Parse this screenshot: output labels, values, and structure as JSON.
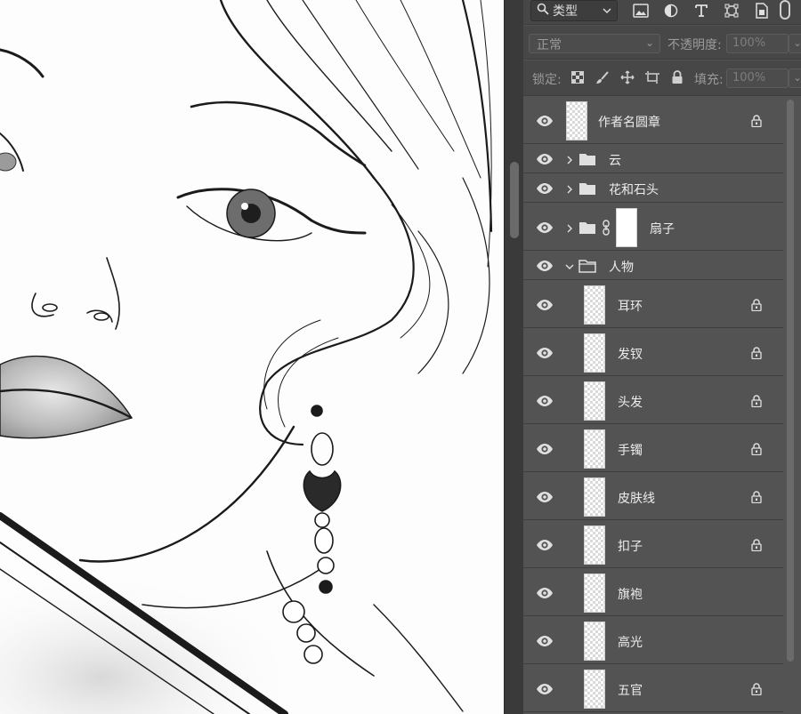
{
  "filter": {
    "kind_label": "类型"
  },
  "blend": {
    "mode": "正常",
    "opacity_label": "不透明度:",
    "opacity_value": "100%"
  },
  "lock": {
    "label": "锁定:",
    "fill_label": "填充:",
    "fill_value": "100%"
  },
  "layers": [
    {
      "name": "作者名圆章",
      "type": "layer",
      "locked": true
    },
    {
      "name": "云",
      "type": "group",
      "collapsed": true
    },
    {
      "name": "花和石头",
      "type": "group",
      "collapsed": true
    },
    {
      "name": "扇子",
      "type": "group",
      "collapsed": true,
      "has_mask": true
    },
    {
      "name": "人物",
      "type": "group",
      "collapsed": false
    },
    {
      "name": "耳环",
      "type": "layer",
      "locked": true
    },
    {
      "name": "发钗",
      "type": "layer",
      "locked": true
    },
    {
      "name": "头发",
      "type": "layer",
      "locked": true
    },
    {
      "name": "手镯",
      "type": "layer",
      "locked": true
    },
    {
      "name": "皮肤线",
      "type": "layer",
      "locked": true
    },
    {
      "name": "扣子",
      "type": "layer",
      "locked": true
    },
    {
      "name": "旗袍",
      "type": "layer",
      "locked": false
    },
    {
      "name": "高光",
      "type": "layer",
      "locked": false
    },
    {
      "name": "五官",
      "type": "layer",
      "locked": true
    }
  ],
  "colors": {
    "panel": "#535353",
    "panel_dark": "#474747",
    "text": "#ececec",
    "canvas": "#fdfdfd"
  }
}
